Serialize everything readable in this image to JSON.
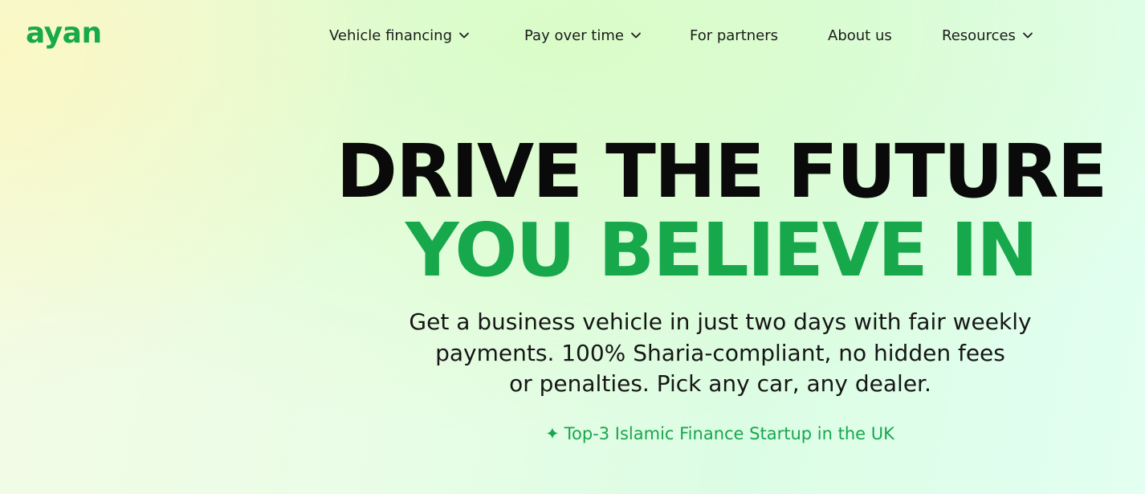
{
  "brand": {
    "logo_text": "ayan",
    "color": "#18a94a"
  },
  "nav": {
    "items": [
      {
        "label": "Vehicle financing",
        "dropdown": true
      },
      {
        "label": "Pay over time",
        "dropdown": true
      },
      {
        "label": "For partners",
        "dropdown": false
      },
      {
        "label": "About us",
        "dropdown": false
      },
      {
        "label": "Resources",
        "dropdown": true
      }
    ]
  },
  "hero": {
    "title_line1": "DRIVE THE FUTURE",
    "title_line2": "YOU BELIEVE IN",
    "title_line1_color": "#0a0a0a",
    "title_line2_color": "#17a84b",
    "subtitle_line1": "Get a business vehicle in just two days with fair weekly",
    "subtitle_line2": "payments. 100% Sharia-compliant, no hidden fees",
    "subtitle_line3": "or penalties. Pick any car, any dealer.",
    "badge_icon": "sparkle-icon",
    "badge_glyph": "✦",
    "badge_text": "Top-3 Islamic Finance Startup in the UK"
  }
}
